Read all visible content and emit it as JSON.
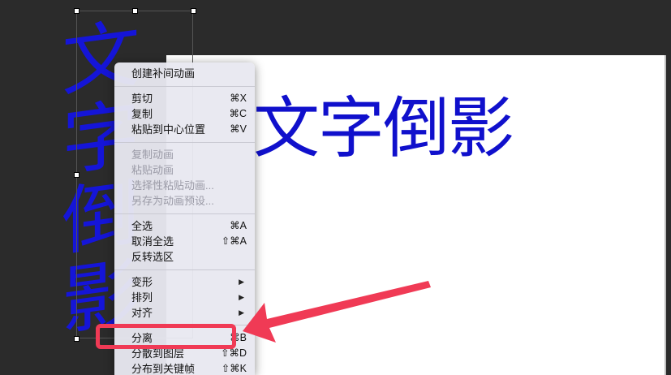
{
  "canvas": {
    "main_text": "文字倒影",
    "reflection_text": "文字倒影"
  },
  "menu": {
    "create_tween": "创建补间动画",
    "cut": {
      "label": "剪切",
      "shortcut": "⌘X"
    },
    "copy": {
      "label": "复制",
      "shortcut": "⌘C"
    },
    "paste_center": {
      "label": "粘贴到中心位置",
      "shortcut": "⌘V"
    },
    "copy_motion": "复制动画",
    "paste_motion": "粘贴动画",
    "paste_motion_special": "选择性粘贴动画...",
    "save_motion_preset": "另存为动画预设...",
    "select_all": {
      "label": "全选",
      "shortcut": "⌘A"
    },
    "deselect_all": {
      "label": "取消全选",
      "shortcut": "⇧⌘A"
    },
    "invert_selection": "反转选区",
    "transform": "变形",
    "arrange": "排列",
    "align": "对齐",
    "break_apart": {
      "label": "分离",
      "shortcut": "⌘B"
    },
    "distribute_layers": {
      "label": "分散到图层",
      "shortcut": "⇧⌘D"
    },
    "distribute_keyframes": {
      "label": "分布到关键帧",
      "shortcut": "⇧⌘K"
    },
    "submenu_arrow": "▶"
  },
  "colors": {
    "text_blue": "#1010cc",
    "annotation_red": "#f03a55"
  }
}
